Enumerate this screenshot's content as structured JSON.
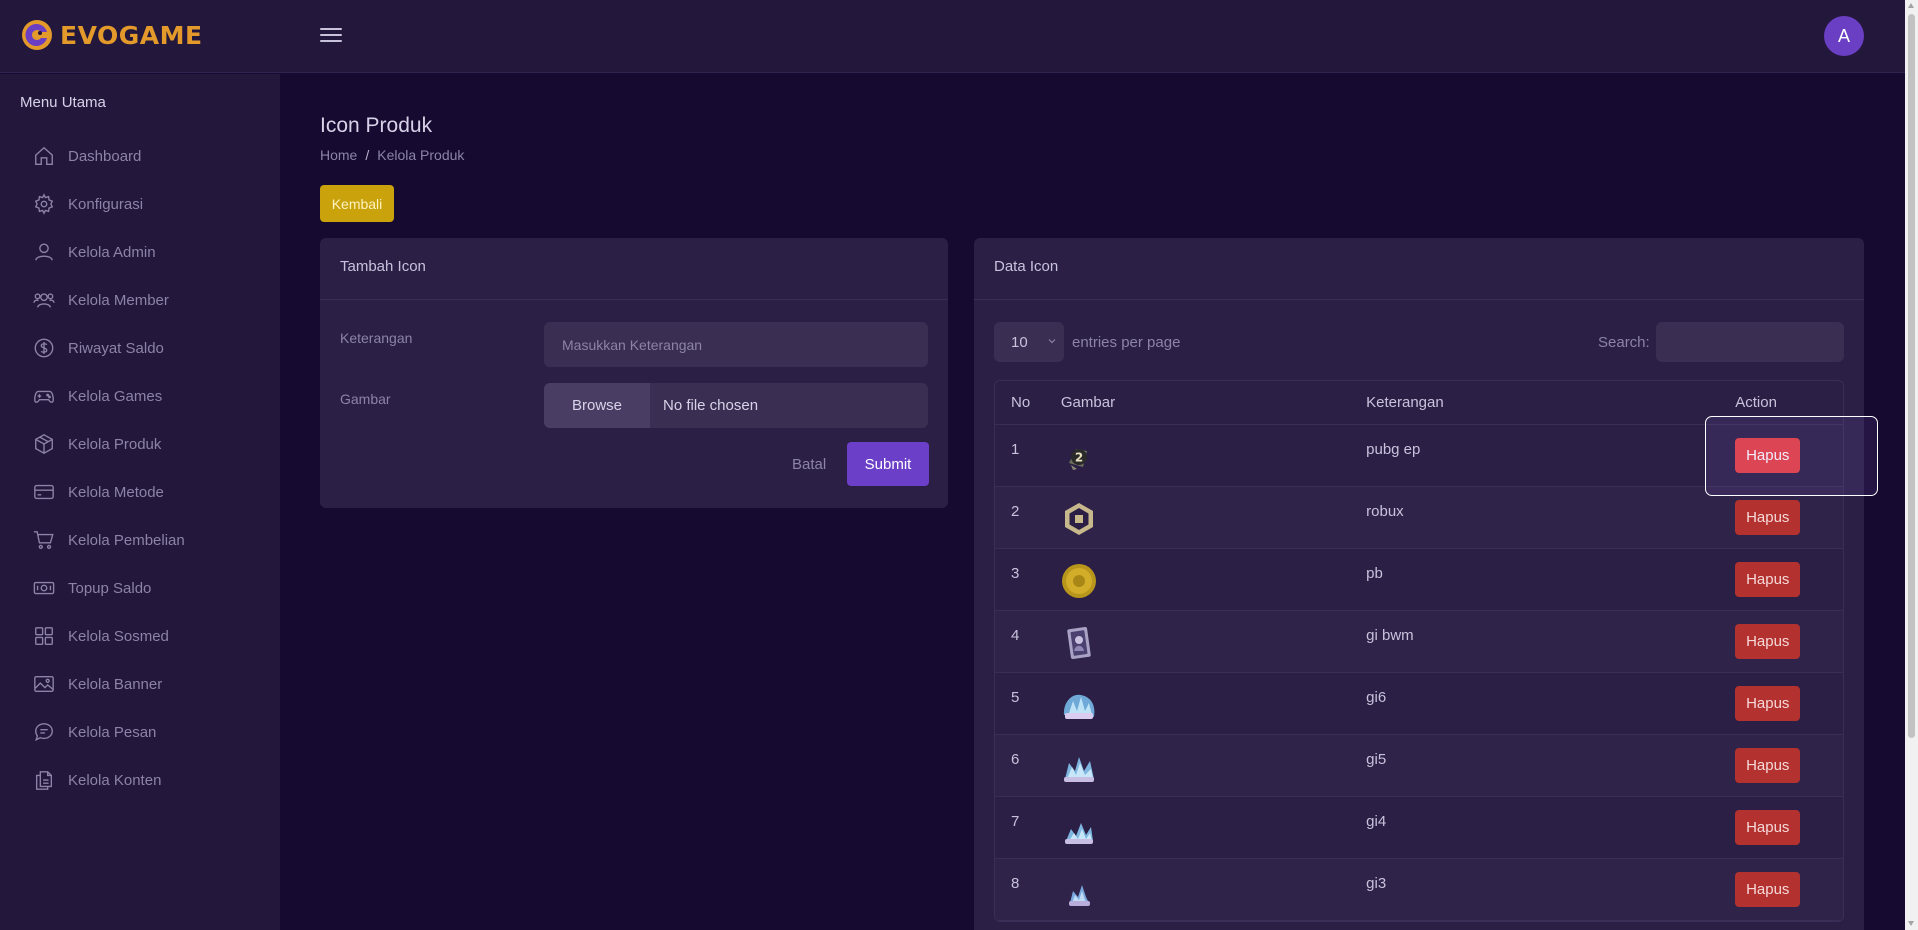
{
  "header": {
    "brand_name": "EVOGAME",
    "avatar_initial": "A"
  },
  "sidebar": {
    "title": "Menu Utama",
    "items": [
      {
        "label": "Dashboard",
        "icon": "home-icon"
      },
      {
        "label": "Konfigurasi",
        "icon": "gear-icon"
      },
      {
        "label": "Kelola Admin",
        "icon": "user-icon"
      },
      {
        "label": "Kelola Member",
        "icon": "users-icon"
      },
      {
        "label": "Riwayat Saldo",
        "icon": "dollar-circle-icon"
      },
      {
        "label": "Kelola Games",
        "icon": "gamepad-icon"
      },
      {
        "label": "Kelola Produk",
        "icon": "box-icon"
      },
      {
        "label": "Kelola Metode",
        "icon": "credit-card-icon"
      },
      {
        "label": "Kelola Pembelian",
        "icon": "cart-icon"
      },
      {
        "label": "Topup Saldo",
        "icon": "cash-icon"
      },
      {
        "label": "Kelola Sosmed",
        "icon": "grid-icon"
      },
      {
        "label": "Kelola Banner",
        "icon": "image-icon"
      },
      {
        "label": "Kelola Pesan",
        "icon": "chat-icon"
      },
      {
        "label": "Kelola Konten",
        "icon": "files-icon"
      }
    ]
  },
  "page": {
    "title": "Icon Produk",
    "breadcrumb": {
      "home": "Home",
      "separator": "/",
      "current": "Kelola Produk"
    },
    "back_button": "Kembali"
  },
  "form": {
    "title": "Tambah Icon",
    "keterangan_label": "Keterangan",
    "keterangan_placeholder": "Masukkan Keterangan",
    "gambar_label": "Gambar",
    "browse_label": "Browse",
    "file_status": "No file chosen",
    "cancel_label": "Batal",
    "submit_label": "Submit"
  },
  "data_table": {
    "title": "Data Icon",
    "entries_value": "10",
    "entries_label": "entries per page",
    "search_label": "Search:",
    "columns": [
      "No",
      "Gambar",
      "Keterangan",
      "Action"
    ],
    "rows": [
      {
        "no": "1",
        "keterangan": "pubg ep",
        "action": "Hapus",
        "thumb": "pubg-ep-icon"
      },
      {
        "no": "2",
        "keterangan": "robux",
        "action": "Hapus",
        "thumb": "robux-icon"
      },
      {
        "no": "3",
        "keterangan": "pb",
        "action": "Hapus",
        "thumb": "pb-coin-icon"
      },
      {
        "no": "4",
        "keterangan": "gi bwm",
        "action": "Hapus",
        "thumb": "gi-bwm-card-icon"
      },
      {
        "no": "5",
        "keterangan": "gi6",
        "action": "Hapus",
        "thumb": "gi6-crystal-icon"
      },
      {
        "no": "6",
        "keterangan": "gi5",
        "action": "Hapus",
        "thumb": "gi5-crystal-icon"
      },
      {
        "no": "7",
        "keterangan": "gi4",
        "action": "Hapus",
        "thumb": "gi4-crystal-icon"
      },
      {
        "no": "8",
        "keterangan": "gi3",
        "action": "Hapus",
        "thumb": "gi3-crystal-icon"
      }
    ]
  },
  "colors": {
    "background": "#160a30",
    "panel": "#23173c",
    "card": "#2b1f45",
    "brand": "#e39a2b",
    "accent": "#6b3fc7",
    "back_button": "#c9a20c",
    "danger": "#b3312e",
    "danger_active": "#e84040"
  }
}
